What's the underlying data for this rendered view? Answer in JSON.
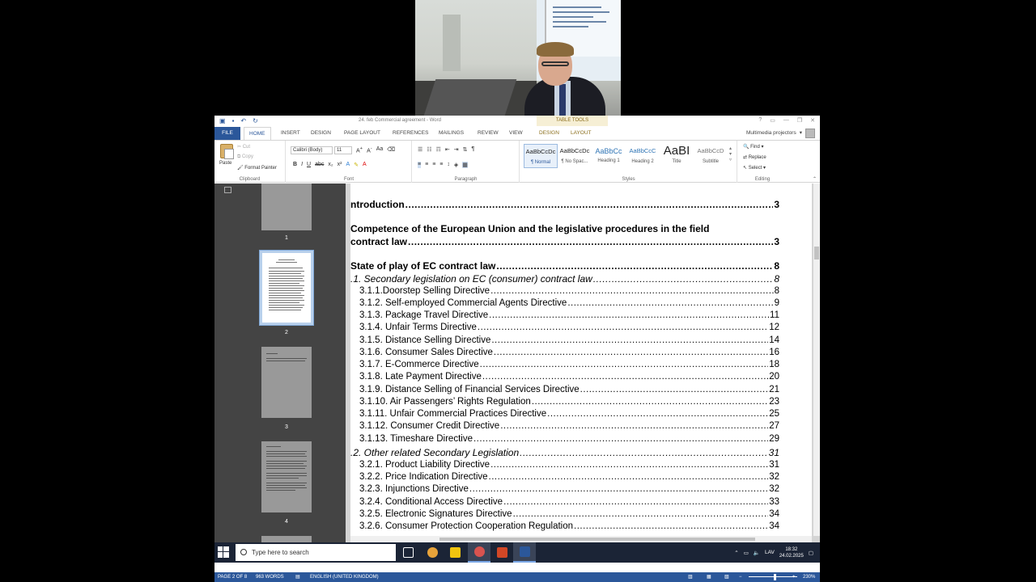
{
  "word": {
    "doc_title": "24. feb Commercial agreement - Word",
    "table_tools_label": "TABLE TOOLS",
    "window_controls": [
      "?",
      "▭",
      "—",
      "❐",
      "✕"
    ],
    "account_name": "Multimedia projectors"
  },
  "tabs": [
    "FILE",
    "HOME",
    "INSERT",
    "DESIGN",
    "PAGE LAYOUT",
    "REFERENCES",
    "MAILINGS",
    "REVIEW",
    "VIEW",
    "DESIGN",
    "LAYOUT"
  ],
  "active_tab": "HOME",
  "ribbon": {
    "clipboard": {
      "paste": "Paste",
      "cut": "Cut",
      "copy": "Copy",
      "format_painter": "Format Painter",
      "label": "Clipboard"
    },
    "font": {
      "name": "Calibri (Body)",
      "size": "11",
      "label": "Font"
    },
    "paragraph": {
      "label": "Paragraph"
    },
    "styles": {
      "label": "Styles",
      "items": [
        {
          "sample": "AaBbCcDc",
          "name": "¶ Normal"
        },
        {
          "sample": "AaBbCcDc",
          "name": "¶ No Spac..."
        },
        {
          "sample": "AaBbCc",
          "name": "Heading 1"
        },
        {
          "sample": "AaBbCcC",
          "name": "Heading 2"
        },
        {
          "sample": "AaBI",
          "name": "Title"
        },
        {
          "sample": "AaBbCcD",
          "name": "Subtitle"
        }
      ]
    },
    "editing": {
      "find": "Find",
      "replace": "Replace",
      "select": "Select",
      "label": "Editing"
    }
  },
  "nav": {
    "page_numbers": [
      "1",
      "2",
      "3",
      "4"
    ]
  },
  "toc": [
    {
      "level": 1,
      "text": "ntroduction",
      "page": "3"
    },
    {
      "level": 1,
      "text": "Competence of the European Union and the legislative procedures in the field",
      "page": ""
    },
    {
      "level": 1,
      "text": "contract law",
      "page": "3"
    },
    {
      "level": 1,
      "text": "State of play of EC contract law",
      "page": "8"
    },
    {
      "level": 2,
      "text": ".1. Secondary legislation on EC (consumer) contract law",
      "page": "8"
    },
    {
      "level": 3,
      "text": "3.1.1.Doorstep Selling Directive",
      "page": "8"
    },
    {
      "level": 3,
      "text": "3.1.2. Self-employed Commercial Agents Directive",
      "page": "9"
    },
    {
      "level": 3,
      "text": "3.1.3. Package Travel Directive",
      "page": "11"
    },
    {
      "level": 3,
      "text": "3.1.4. Unfair Terms Directive",
      "page": "12"
    },
    {
      "level": 3,
      "text": "3.1.5. Distance Selling Directive",
      "page": "14"
    },
    {
      "level": 3,
      "text": "3.1.6. Consumer Sales Directive",
      "page": "16"
    },
    {
      "level": 3,
      "text": "3.1.7. E-Commerce Directive",
      "page": "18"
    },
    {
      "level": 3,
      "text": "3.1.8. Late Payment Directive",
      "page": "20"
    },
    {
      "level": 3,
      "text": "3.1.9. Distance Selling of Financial Services Directive",
      "page": "21"
    },
    {
      "level": 3,
      "text": "3.1.10. Air Passengers’ Rights Regulation",
      "page": "23"
    },
    {
      "level": 3,
      "text": "3.1.11. Unfair Commercial Practices Directive",
      "page": "25"
    },
    {
      "level": 3,
      "text": "3.1.12. Consumer Credit Directive",
      "page": "27"
    },
    {
      "level": 3,
      "text": "3.1.13. Timeshare Directive",
      "page": "29"
    },
    {
      "level": 2,
      "text": ".2. Other related Secondary Legislation",
      "page": "31"
    },
    {
      "level": 3,
      "text": "3.2.1. Product Liability Directive",
      "page": "31"
    },
    {
      "level": 3,
      "text": "3.2.2. Price Indication Directive",
      "page": "32"
    },
    {
      "level": 3,
      "text": "3.2.3. Injunctions Directive",
      "page": "32"
    },
    {
      "level": 3,
      "text": "3.2.4. Conditional Access Directive",
      "page": "33"
    },
    {
      "level": 3,
      "text": "3.2.5. Electronic Signatures Directive",
      "page": "34"
    },
    {
      "level": 3,
      "text": "3.2.6. Consumer Protection Cooperation Regulation",
      "page": "34"
    }
  ],
  "taskbar": {
    "search_placeholder": "Type here to search",
    "language": "LAV",
    "time": "18:32",
    "date": "24.02.2025",
    "apps": [
      {
        "name": "task-view",
        "color": "#ffffff"
      },
      {
        "name": "chrome",
        "color": "#e8a33a"
      },
      {
        "name": "file-explorer",
        "color": "#f1c40f"
      },
      {
        "name": "chrome-alt",
        "color": "#d9534f"
      },
      {
        "name": "powerpoint",
        "color": "#d24726"
      },
      {
        "name": "word",
        "color": "#2b579a"
      }
    ]
  },
  "statusbar": {
    "page": "PAGE 2 OF 8",
    "words": "963 WORDS",
    "language": "ENGLISH (UNITED KINGDOM)",
    "zoom": "230%"
  },
  "colors": {
    "accent": "#2b579a",
    "nav_bg": "#444444",
    "taskbar_bg": "#1b2436"
  }
}
